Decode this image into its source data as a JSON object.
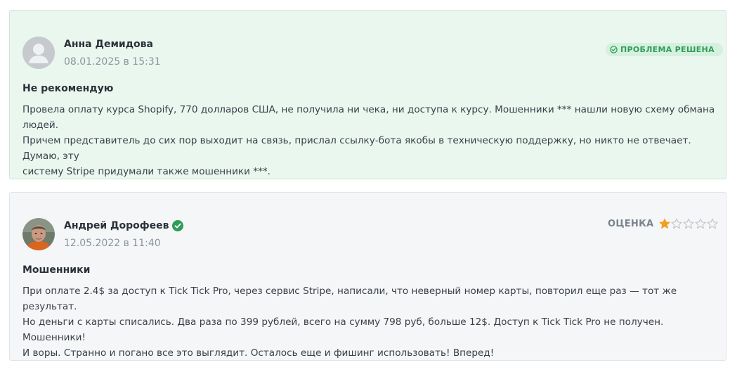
{
  "reviews": [
    {
      "author": "Анна Демидова",
      "date": "08.01.2025 в 15:31",
      "status_badge": "ПРОБЛЕМА РЕШЕНА",
      "title": "Не рекомендую",
      "body_lines": [
        "Провела оплату курса Shopify, 770 долларов США, не получила ни чека, ни доступа к курсу. Мошенники *** нашли новую схему обмана людей.",
        "Причем представитель до сих пор выходит на связь, прислал ссылку-бота якобы в техническую поддержку, но никто не отвечает. Думаю, эту",
        "систему Stripe придумали также мошенники ***."
      ],
      "avatar_icon": "default-user-icon",
      "background_color": "#eaf7ef"
    },
    {
      "author": "Андрей Дорофеев",
      "verified": true,
      "date": "12.05.2022 в 11:40",
      "rating_label": "ОЦЕНКА",
      "rating_value": 1,
      "rating_max": 5,
      "title": "Мошенники",
      "body_lines": [
        "При оплате 2.4$ за доступ к Tick Tick Pro, через сервис Stripe, написали, что неверный номер карты, повторил еще раз — тот же результат.",
        "Но деньги с карты списались. Два раза по 399 рублей, всего на сумму 798 руб, больше 12$. Доступ к Tick Tick Pro не получен. Мошенники!",
        "И воры. Странно и погано все это выглядит. Осталось еще и фишинг использовать! Вперед!"
      ],
      "avatar_icon": "user-photo",
      "background_color": "#f5f6f8"
    }
  ],
  "colors": {
    "accent_green": "#2f9d57",
    "star_filled": "#f0a020",
    "star_empty": "#b8bfc6"
  }
}
